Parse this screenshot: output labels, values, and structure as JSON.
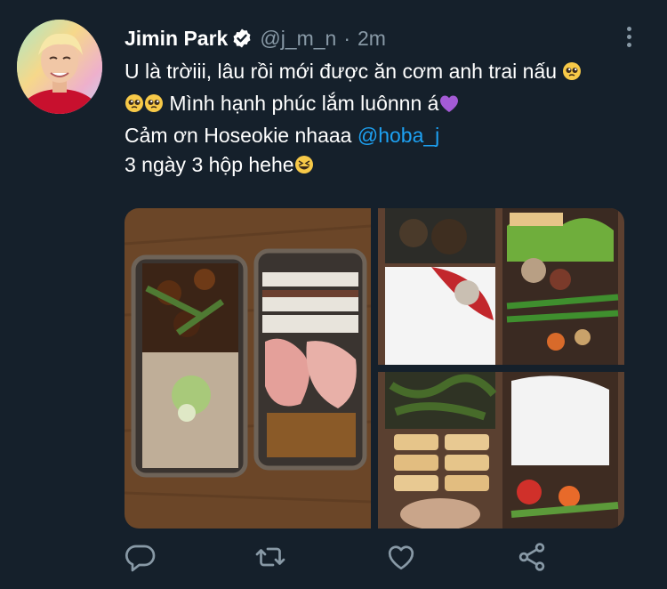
{
  "tweet": {
    "author_name": "Jimin Park",
    "handle": "@j_m_n",
    "separator": "·",
    "time": "2m",
    "line1": "U là trờiii, lâu rồi mới được ăn cơm anh trai nấu",
    "line2": "Mình hạnh phúc lắm luônnn á",
    "line3_prefix": "Cảm ơn Hoseokie nhaaa",
    "mention": "@hoba_j",
    "line4": "3 ngày 3 hộp hehe"
  },
  "icons": {
    "verified": "verified-badge-icon",
    "more": "more-vertical-icon",
    "reply": "reply-icon",
    "retweet": "retweet-icon",
    "like": "heart-icon",
    "share": "share-icon",
    "emoji_pleading": "pleading-face-emoji",
    "emoji_heart": "purple-heart-emoji",
    "emoji_laugh": "grinning-squinting-face-emoji"
  },
  "colors": {
    "background": "#15202b",
    "text": "#ffffff",
    "secondary": "#8899a6",
    "accent": "#1da1f2"
  }
}
